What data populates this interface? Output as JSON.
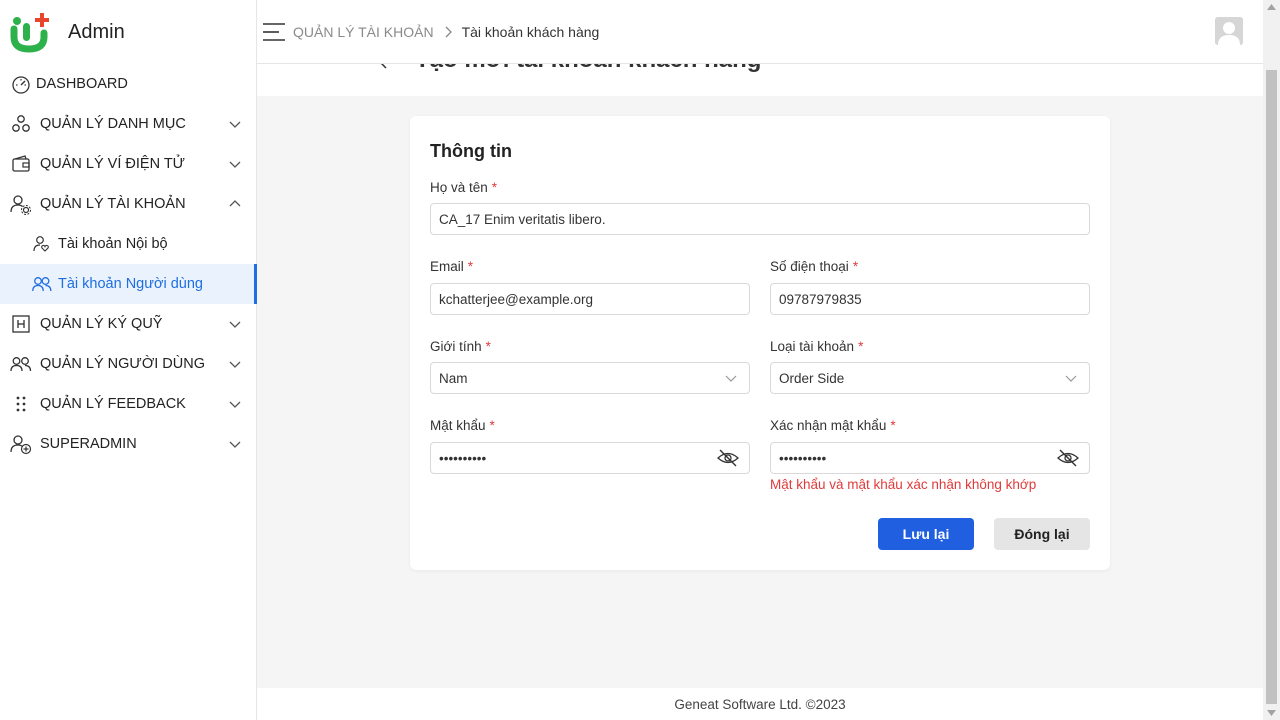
{
  "app": {
    "title": "Admin"
  },
  "sidebar": {
    "items": [
      {
        "label": "DASHBOARD"
      },
      {
        "label": "QUẢN LÝ DANH MỤC"
      },
      {
        "label": "QUẢN LÝ VÍ ĐIỆN TỬ"
      },
      {
        "label": "QUẢN LÝ TÀI KHOẢN"
      },
      {
        "label": "Tài khoản Nội bộ"
      },
      {
        "label": "Tài khoản Người dùng"
      },
      {
        "label": "QUẢN LÝ KÝ QUỸ"
      },
      {
        "label": "QUẢN LÝ NGƯỜI DÙNG"
      },
      {
        "label": "QUẢN LÝ FEEDBACK"
      },
      {
        "label": "SUPERADMIN"
      }
    ]
  },
  "breadcrumb": {
    "parent": "QUẢN LÝ TÀI KHOẢN",
    "current": "Tài khoản khách hàng"
  },
  "page": {
    "title": "Tạo mới tài khoản khách hàng"
  },
  "form": {
    "section_title": "Thông tin",
    "required_mark": "*",
    "full_name": {
      "label": "Họ và tên",
      "value": "CA_17 Enim veritatis libero."
    },
    "email": {
      "label": "Email",
      "value": "kchatterjee@example.org"
    },
    "phone": {
      "label": "Số điện thoại",
      "value": "09787979835"
    },
    "gender": {
      "label": "Giới tính",
      "value": "Nam"
    },
    "account_type": {
      "label": "Loại tài khoản",
      "value": "Order Side"
    },
    "password": {
      "label": "Mật khẩu",
      "value": "••••••••••"
    },
    "confirm_password": {
      "label": "Xác nhận mật khẩu",
      "value": "••••••••••"
    },
    "error": "Mật khẩu và mật khẩu xác nhận không khớp",
    "save_label": "Lưu lại",
    "close_label": "Đóng lại"
  },
  "footer": {
    "text": "Geneat Software Ltd. ©2023"
  },
  "colors": {
    "primary": "#1f5fe0",
    "active_menu": "#1f6fe0",
    "error": "#e03b3b",
    "logo_green": "#2db14a",
    "logo_red": "#e8462c"
  }
}
